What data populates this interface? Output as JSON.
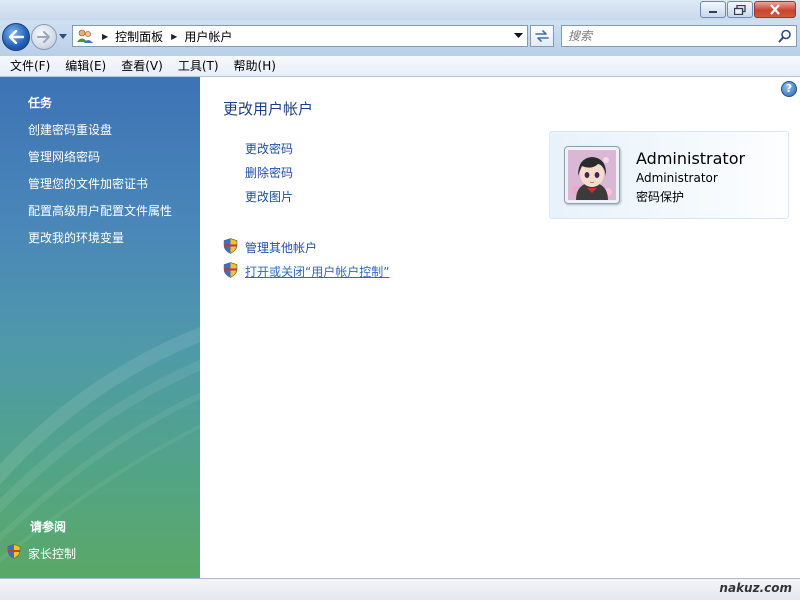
{
  "address": {
    "breadcrumbs": [
      "控制面板",
      "用户帐户"
    ],
    "search_placeholder": "搜索"
  },
  "menu": [
    "文件(F)",
    "编辑(E)",
    "查看(V)",
    "工具(T)",
    "帮助(H)"
  ],
  "sidebar": {
    "tasks_heading": "任务",
    "tasks": [
      "创建密码重设盘",
      "管理网络密码",
      "管理您的文件加密证书",
      "配置高级用户配置文件属性",
      "更改我的环境变量"
    ],
    "see_also_heading": "请参阅",
    "see_also": [
      "家长控制"
    ]
  },
  "main": {
    "title": "更改用户帐户",
    "links": [
      "更改密码",
      "删除密码",
      "更改图片"
    ],
    "shield_links": [
      "管理其他帐户",
      "打开或关闭“用户帐户控制”"
    ],
    "help_glyph": "?"
  },
  "account": {
    "name": "Administrator",
    "type": "Administrator",
    "status": "密码保护"
  },
  "statusbar": {
    "watermark": "nakuz.com"
  },
  "colors": {
    "link": "#1e4fa8",
    "title": "#1e3f88",
    "sidebar_top": "#3d73b5",
    "sidebar_bottom": "#5aa867"
  }
}
